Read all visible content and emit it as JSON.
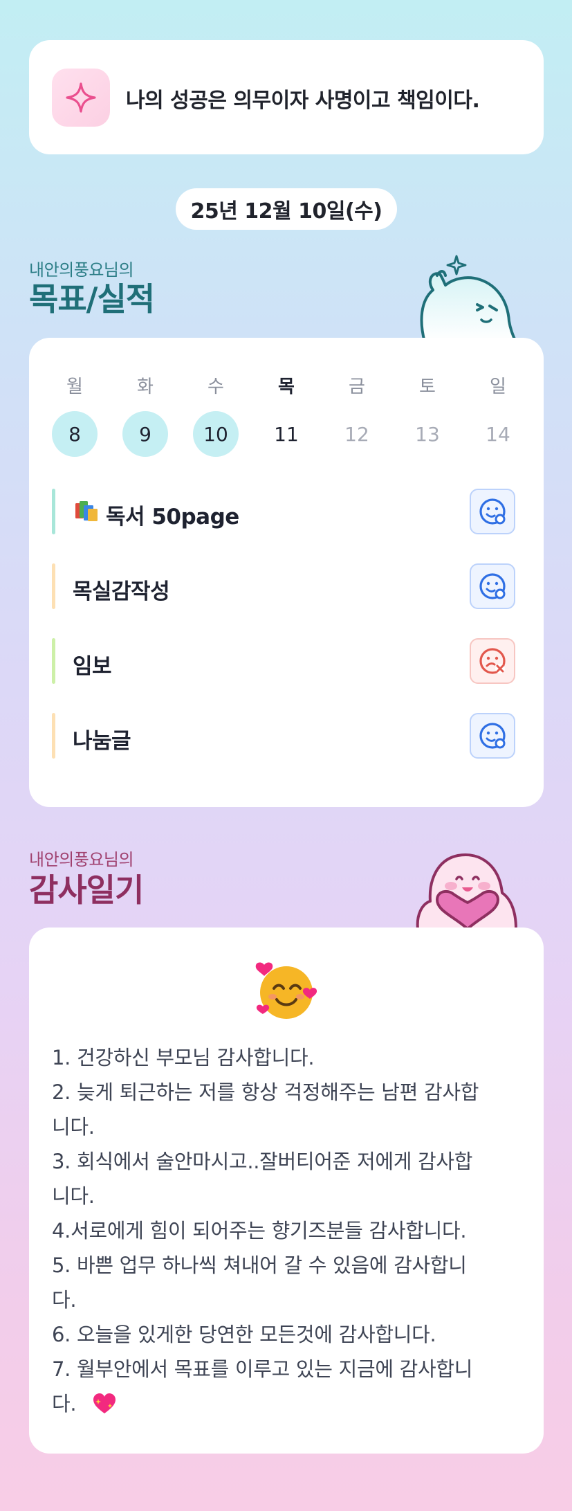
{
  "quote": {
    "icon": "sparkle-icon",
    "text": "나의 성공은 의무이자 사명이고 책임이다."
  },
  "date": "25년 12월 10일(수)",
  "goals_section": {
    "subtitle": "내안의풍요님의",
    "title": "목표/실적"
  },
  "week": {
    "days": [
      {
        "label": "월",
        "num": "8",
        "state": "done"
      },
      {
        "label": "화",
        "num": "9",
        "state": "done"
      },
      {
        "label": "수",
        "num": "10",
        "state": "done"
      },
      {
        "label": "목",
        "num": "11",
        "state": "today"
      },
      {
        "label": "금",
        "num": "12",
        "state": "future"
      },
      {
        "label": "토",
        "num": "13",
        "state": "future"
      },
      {
        "label": "일",
        "num": "14",
        "state": "future"
      }
    ]
  },
  "goals": [
    {
      "text": "독서 50page",
      "icon": "books-icon",
      "bar_color": "#a8e6d9",
      "status": "success"
    },
    {
      "text": "목실감작성",
      "icon": "",
      "bar_color": "#fde0b4",
      "status": "success"
    },
    {
      "text": "임보",
      "icon": "",
      "bar_color": "#cdf0a8",
      "status": "fail"
    },
    {
      "text": "나눔글",
      "icon": "",
      "bar_color": "#fde0b4",
      "status": "success"
    }
  ],
  "gratitude_section": {
    "subtitle": "내안의풍요님의",
    "title": "감사일기"
  },
  "gratitude": {
    "emoji": "smiling-face-with-hearts-icon",
    "lines": [
      "1. 건강하신 부모님 감사합니다.",
      "2. 늦게 퇴근하는 저를 항상 걱정해주는 남편 감사합",
      "니다.",
      "3. 회식에서 술안마시고..잘버티어준 저에게 감사합",
      "니다.",
      "4.서로에게 힘이 되어주는 향기즈분들 감사합니다.",
      "5. 바쁜 업무 하나씩 쳐내어 갈 수 있음에 감사합니",
      "다.",
      "6. 오늘을 있게한 당연한 모든것에 감사합니다.",
      "7. 월부안에서 목표를 이루고 있는 지금에 감사합니",
      "다."
    ],
    "end_icon": "sparkling-heart-icon"
  },
  "colors": {
    "success": "#2f6fe4",
    "fail": "#e2574c",
    "done_day": "#c5eff3",
    "goals_title": "#1f6f78",
    "gratitude_title": "#8e2f60"
  }
}
